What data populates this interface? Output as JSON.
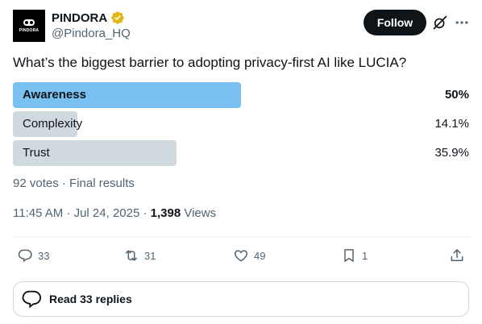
{
  "author": {
    "display_name": "PINDORA",
    "handle": "@Pindora_HQ",
    "avatar_text": "PINDORA",
    "verified_badge": "gold-verified-badge-icon"
  },
  "header": {
    "follow_label": "Follow",
    "grok_icon": "grok-slash-icon",
    "more_icon": "more-horizontal-icon"
  },
  "post": {
    "question": "What’s the biggest barrier to adopting privacy-first AI like LUCIA?"
  },
  "poll": {
    "options": [
      {
        "label": "Awareness",
        "percent_text": "50%",
        "fraction": 0.5,
        "winner": true
      },
      {
        "label": "Complexity",
        "percent_text": "14.1%",
        "fraction": 0.141,
        "winner": false
      },
      {
        "label": "Trust",
        "percent_text": "35.9%",
        "fraction": 0.359,
        "winner": false
      }
    ],
    "summary": "92 votes · Final results",
    "winner_color": "#79c1f1",
    "bar_color": "#cfd9de"
  },
  "timestamp": {
    "text": "11:45 AM · Jul 24, 2025 · ",
    "views_count": "1,398",
    "views_label": " Views"
  },
  "actions": {
    "reply_count": "33",
    "repost_count": "31",
    "like_count": "49",
    "bookmark_count": "1"
  },
  "replies_button": {
    "label": "Read 33 replies"
  }
}
